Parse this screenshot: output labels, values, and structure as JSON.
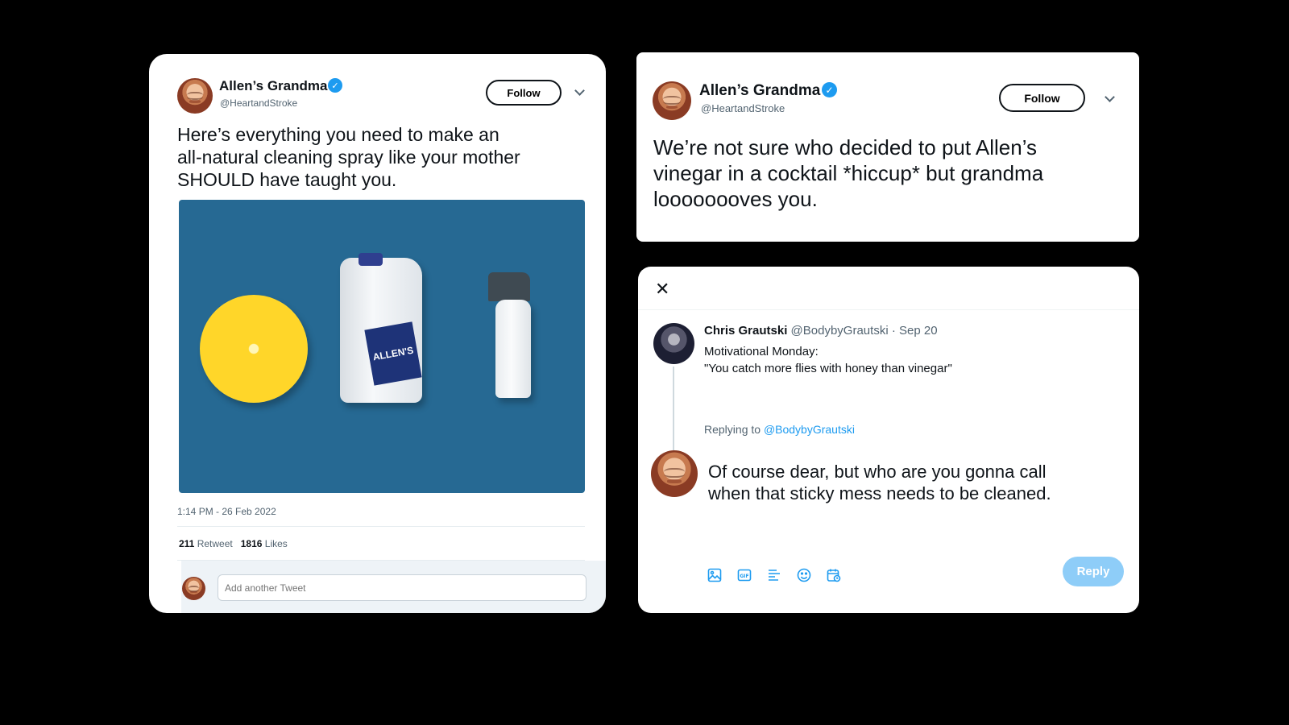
{
  "tweet_a": {
    "name": "Allen’s Grandma",
    "handle": "@HeartandStroke",
    "follow_label": "Follow",
    "text": "Here’s everything you need to make an\nall-natural cleaning spray like your mother\nSHOULD have taught you.",
    "media_label": "ALLEN'S",
    "timestamp": "1:14 PM - 26 Feb 2022",
    "retweets_count": "211",
    "retweets_label": "Retweet",
    "likes_count": "1816",
    "likes_label": "Likes",
    "reply_placeholder": "Add another Tweet"
  },
  "tweet_b": {
    "name": "Allen’s Grandma",
    "handle": "@HeartandStroke",
    "follow_label": "Follow",
    "text": "We’re not sure who decided to put Allen’s\nvinegar in a cocktail *hiccup* but grandma\nloooooooves you."
  },
  "reply_modal": {
    "original": {
      "name": "Chris Grautski",
      "handle": "@BodybyGrautski",
      "date": "· Sep 20",
      "text": "Motivational Monday:\n\"You catch more flies with honey than vinegar\""
    },
    "replying_to_label": "Replying to",
    "replying_to_handle": "@BodybyGrautski",
    "reply_text": "Of course dear, but who are you gonna call\nwhen that sticky mess needs to be cleaned.",
    "reply_button_label": "Reply",
    "toolbar_icons": [
      "image-icon",
      "gif-icon",
      "poll-icon",
      "emoji-icon",
      "schedule-icon"
    ]
  },
  "colors": {
    "background": "#000000",
    "twitter_blue": "#1d9bf0",
    "reply_button_disabled": "#8ecdf8",
    "media_background": "#266993"
  }
}
